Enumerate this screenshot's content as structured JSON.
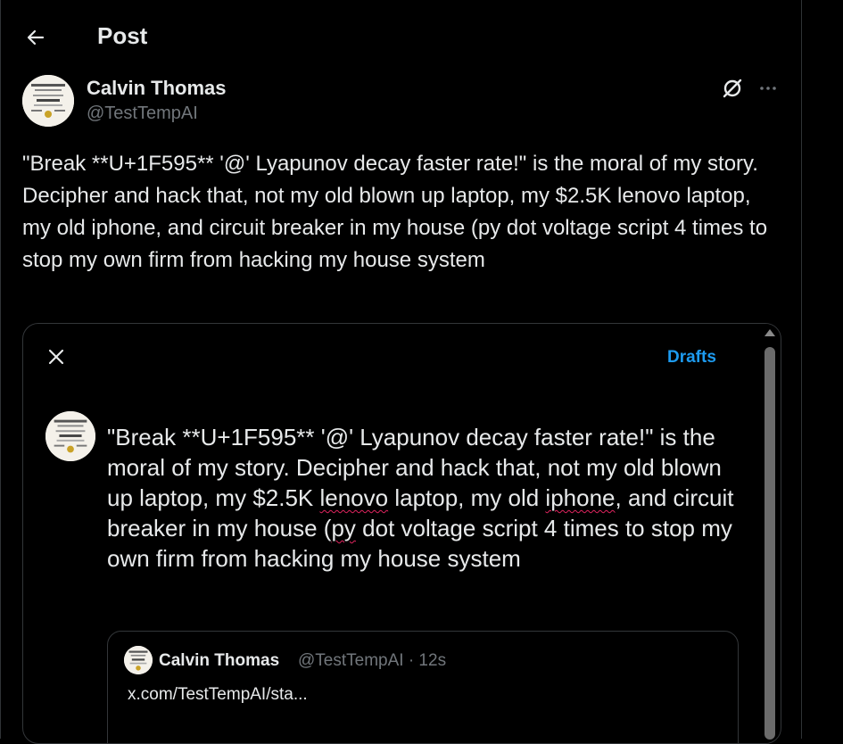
{
  "header": {
    "title": "Post"
  },
  "post": {
    "author_name": "Calvin Thomas",
    "author_handle": "@TestTempAI",
    "text": "\"Break **U+1F595** '@' Lyapunov decay faster rate!\" is the moral of my story. Decipher and hack that, not my old blown up laptop, my $2.5K lenovo laptop, my old iphone, and circuit breaker in my house (py dot voltage script 4 times to stop my own firm from hacking my house system"
  },
  "embed": {
    "drafts_label": "Drafts",
    "compose": {
      "part1": "\"Break **U+1F595** '@' Lyapunov decay faster rate!\" is the moral of my story. Decipher and hack that, not my old blown up laptop, my $2.5K ",
      "lenovo": "lenovo",
      "part2": " laptop, my old ",
      "iphone": "iphone",
      "part3": ", and circuit breaker in my house (",
      "py": "py",
      "part4": " dot voltage script 4 times to stop my own firm from hacking my house system"
    },
    "quote": {
      "author_name": "Calvin Thomas",
      "meta": "@TestTempAI · 12s",
      "link": "x.com/TestTempAI/sta..."
    }
  },
  "icons": {
    "back": "arrow-left-icon",
    "grok": "grok-icon",
    "more": "more-horizontal-icon",
    "close": "close-icon"
  },
  "colors": {
    "background": "#000000",
    "text": "#e7e9ea",
    "muted": "#71767b",
    "accent": "#1d9bf0",
    "border": "#333639",
    "spellcheck": "#e0245e"
  }
}
